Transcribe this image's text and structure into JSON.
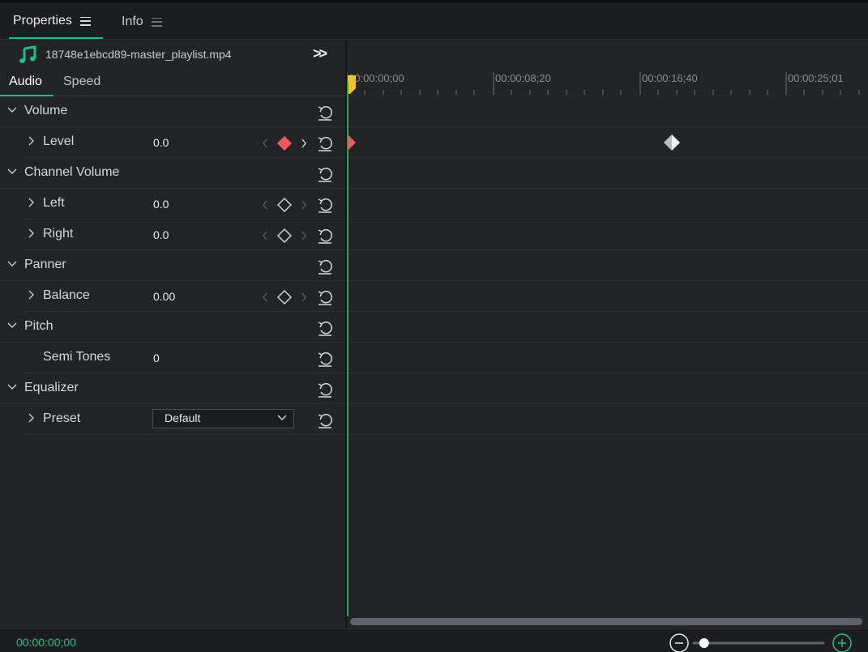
{
  "tabs": [
    {
      "label": "Properties",
      "active": true
    },
    {
      "label": "Info",
      "active": false
    }
  ],
  "clip": {
    "icon": "music-note-icon",
    "filename": "18748e1ebcd89-master_playlist.mp4",
    "expand_glyph": ">>"
  },
  "subtabs": [
    {
      "label": "Audio",
      "active": true
    },
    {
      "label": "Speed",
      "active": false
    }
  ],
  "groups": {
    "volume": {
      "label": "Volume",
      "level": {
        "label": "Level",
        "value": "0.0",
        "keyframe": "active"
      }
    },
    "channel_volume": {
      "label": "Channel Volume",
      "left": {
        "label": "Left",
        "value": "0.0"
      },
      "right": {
        "label": "Right",
        "value": "0.0"
      }
    },
    "panner": {
      "label": "Panner",
      "balance": {
        "label": "Balance",
        "value": "0.00"
      }
    },
    "pitch": {
      "label": "Pitch",
      "semi_tones": {
        "label": "Semi Tones",
        "value": "0"
      }
    },
    "equalizer": {
      "label": "Equalizer",
      "preset": {
        "label": "Preset",
        "value": "Default"
      }
    }
  },
  "timeline": {
    "ruler_labels": [
      "00:00:00;00",
      "00:00:08;20",
      "00:00:16;40",
      "00:00:25;01"
    ],
    "keyframes": [
      {
        "track": "Level",
        "time": "00:00:00;00",
        "style": "red"
      },
      {
        "track": "Level",
        "time": "00:00:18;00",
        "style": "split-gray"
      }
    ]
  },
  "footer": {
    "timecode": "00:00:00;00",
    "zoom_level": 0.08
  },
  "colors": {
    "accent": "#1fbf84",
    "keyframe_active": "#f05a5a",
    "playhead": "#f2c12e",
    "playhead_line": "#2aa84a"
  }
}
